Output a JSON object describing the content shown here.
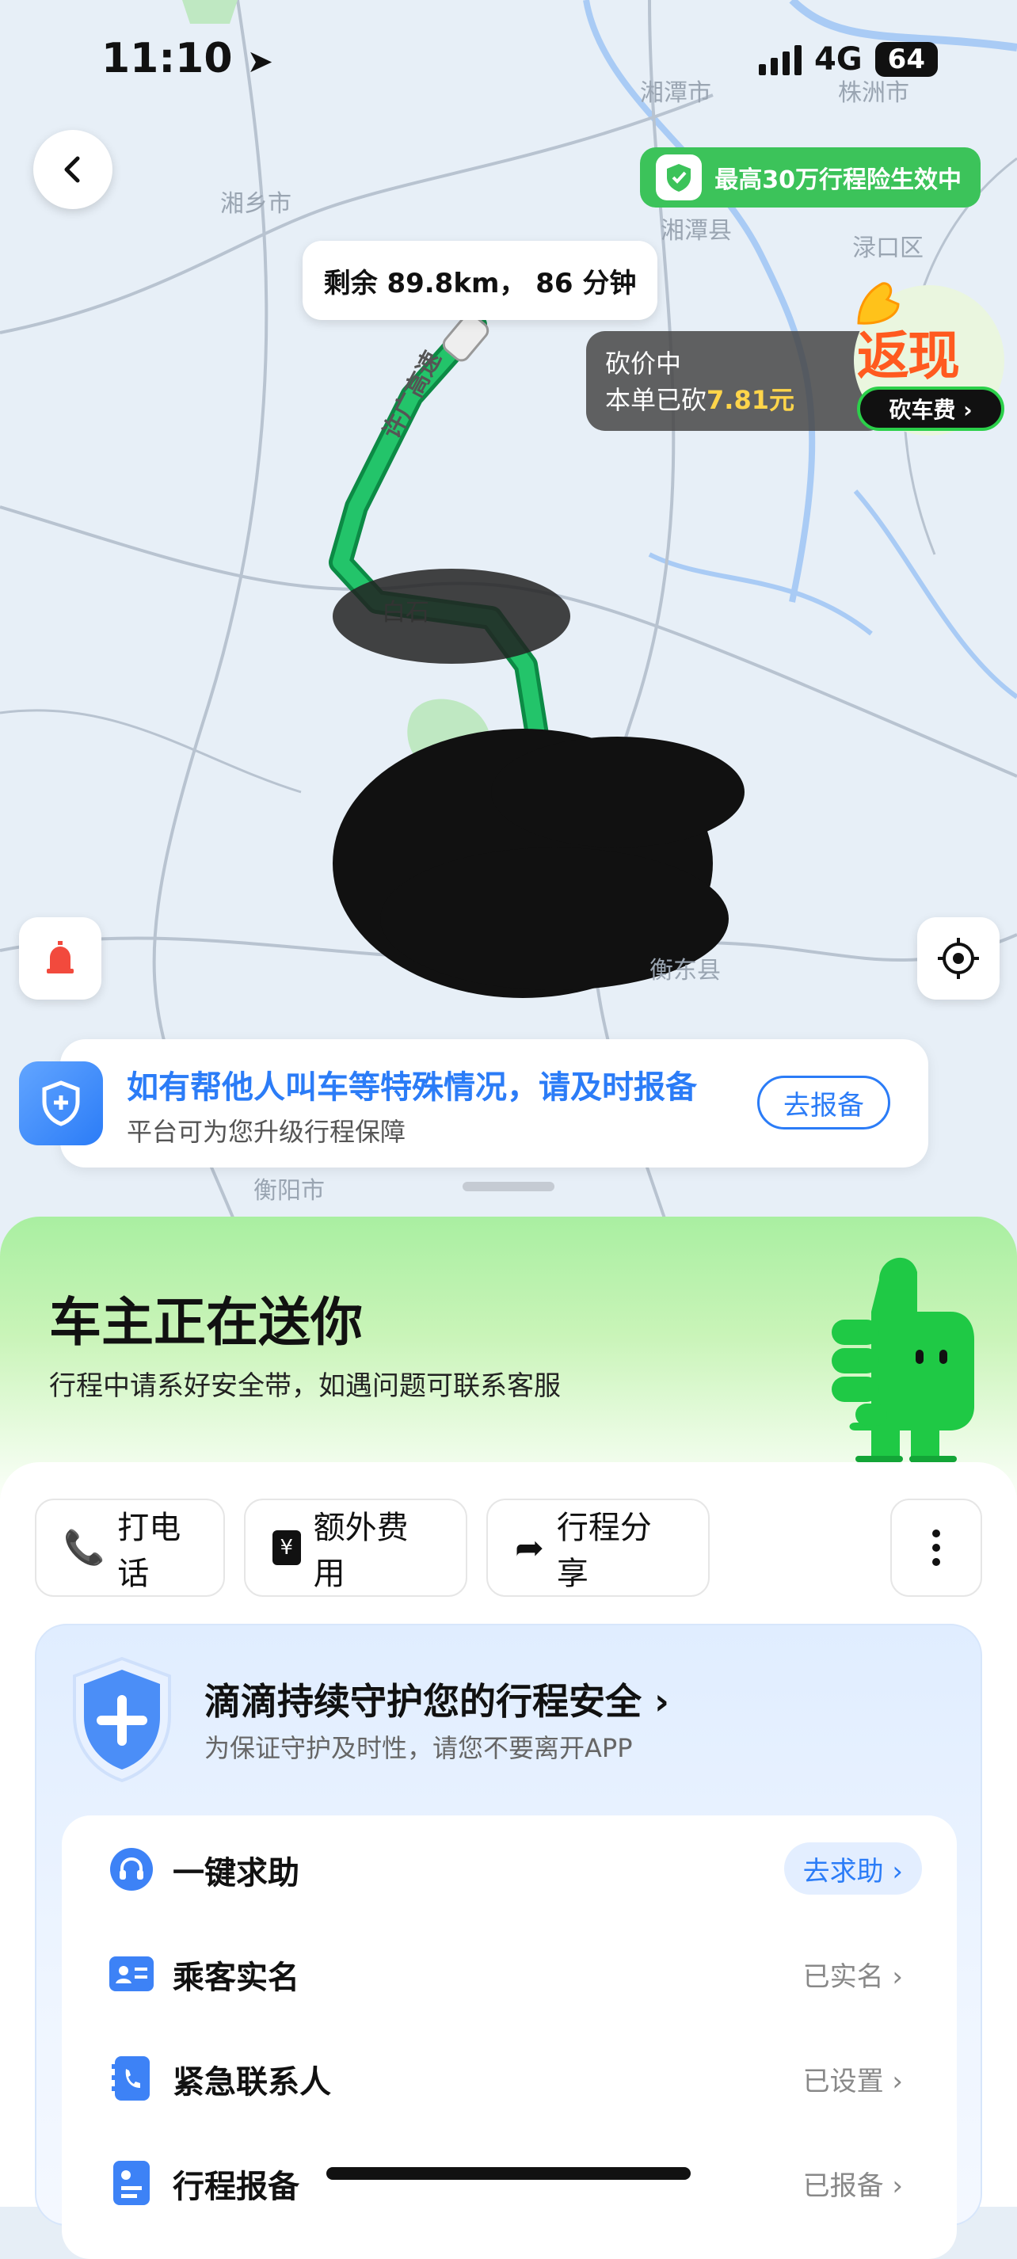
{
  "status_bar": {
    "time": "11:10",
    "network": "4G",
    "battery": "64"
  },
  "map": {
    "cities": [
      "湘潭市",
      "株洲市",
      "湘乡市",
      "湘潭县",
      "渌口区",
      "衡阳市",
      "衡东县"
    ],
    "road_label": "许广高速",
    "place_label": "白石"
  },
  "insurance_badge": "最高30万行程险生效中",
  "trip_remaining": "剩余 89.8km， 86 分钟",
  "bargain": {
    "status": "砍价中",
    "prefix": "本单已砍",
    "amount": "7.81元"
  },
  "cashback": {
    "big": "返现",
    "pill": "砍车费 ›"
  },
  "notice": {
    "title": "如有帮他人叫车等特殊情况，请及时报备",
    "sub": "平台可为您升级行程保障",
    "button": "去报备"
  },
  "sheet": {
    "title": "车主正在送你",
    "subtitle": "行程中请系好安全带，如遇问题可联系客服"
  },
  "actions": [
    {
      "label": "打电话",
      "icon": "phone-icon"
    },
    {
      "label": "额外费用",
      "icon": "fee-icon"
    },
    {
      "label": "行程分享",
      "icon": "share-icon"
    }
  ],
  "safety": {
    "title": "滴滴持续守护您的行程安全",
    "subtitle": "为保证守护及时性，请您不要离开APP",
    "rows": [
      {
        "label": "一键求助",
        "value": "去求助 ›",
        "icon": "headset-icon"
      },
      {
        "label": "乘客实名",
        "value": "已实名 ›",
        "icon": "id-card-icon"
      },
      {
        "label": "紧急联系人",
        "value": "已设置 ›",
        "icon": "contact-phone-icon"
      },
      {
        "label": "行程报备",
        "value": "已报备 ›",
        "icon": "report-icon"
      }
    ]
  },
  "colors": {
    "accent": "#2b7cf7",
    "green": "#3cc35a",
    "route": "#1aa85a"
  }
}
